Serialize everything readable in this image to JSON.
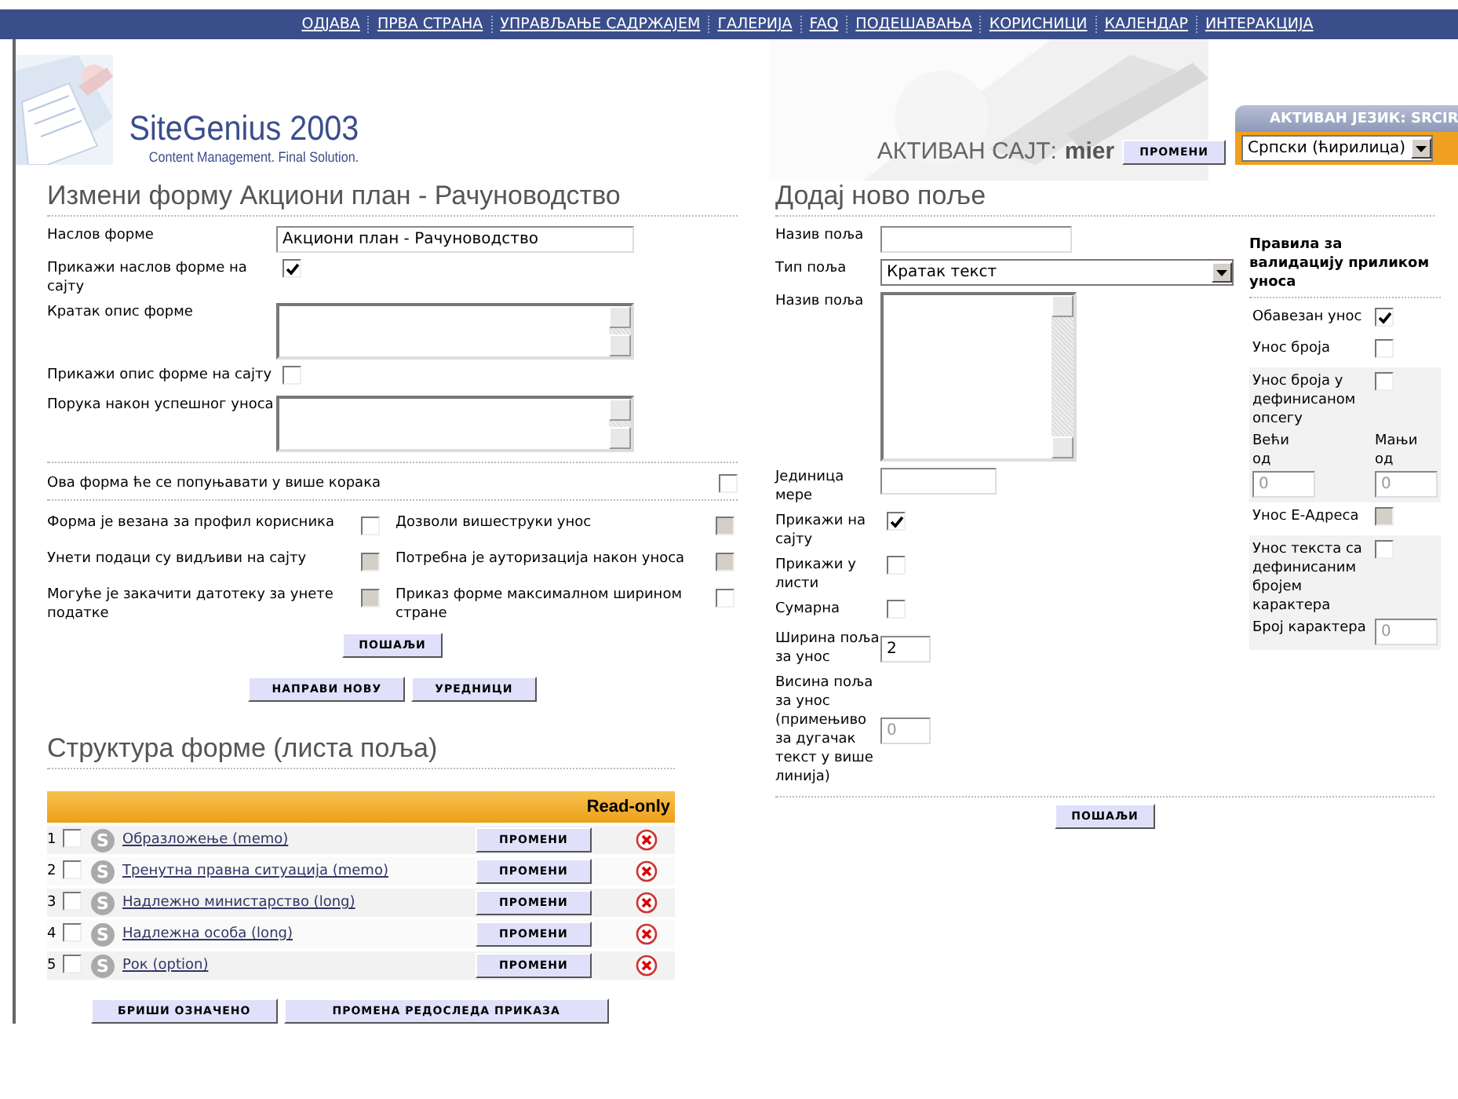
{
  "nav": [
    "ОДЈАВА",
    "ПРВА СТРАНА",
    "УПРАВЉАЊЕ САДРЖАЈЕМ",
    "ГАЛЕРИЈА",
    "FAQ",
    "ПОДЕШАВАЊА",
    "КОРИСНИЦИ",
    "КАЛЕНДАР",
    "ИНТЕРАКЦИЈА"
  ],
  "header": {
    "logo_title": "SiteGenius 2003",
    "logo_tagline": "Content Management. Final Solution.",
    "site_label": "АКТИВАН САЈТ:",
    "site_name": "mier",
    "change_button": "ПРОМЕНИ",
    "language_label": "АКТИВАН ЈЕЗИК: SRCIR",
    "language": "Српски (ћирилица)"
  },
  "edit_form": {
    "title": "Измени форму Акциони план - Рачуноводство",
    "fields": [
      {
        "kind": "text",
        "label": "Наслов форме",
        "value": "Акциони план - Рачуноводство"
      },
      {
        "kind": "checkbox",
        "label": "Прикажи наслов форме на сајту",
        "checked": true
      },
      {
        "kind": "textarea",
        "label": "Кратак опис форме"
      },
      {
        "kind": "checkbox",
        "label": "Прикажи опис форме на сајту",
        "checked": false
      },
      {
        "kind": "textarea",
        "label": "Порука након успешног уноса"
      }
    ],
    "wide_option": {
      "label": "Ова форма ће се попуњавати у више корака",
      "checked": false,
      "disabled": false
    },
    "options": [
      {
        "label": "Форма је везана за профил корисника",
        "checked": false,
        "disabled": false
      },
      {
        "label": "Дозволи вишеструки унос",
        "checked": false,
        "disabled": true
      },
      {
        "label": "Унети подаци су видљиви на сајту",
        "checked": false,
        "disabled": true
      },
      {
        "label": "Потребна је ауторизација након уноса",
        "checked": false,
        "disabled": true
      },
      {
        "label": "Могуће је закачити датотеку за унете податке",
        "checked": false,
        "disabled": true
      },
      {
        "label": "Приказ форме максималном ширином стране",
        "checked": false,
        "disabled": false
      }
    ],
    "submit": "ПОШАЉИ",
    "buttons": [
      "НАПРАВИ НОВУ",
      "УРЕДНИЦИ"
    ]
  },
  "structure": {
    "title": "Структура форме (листа поља)",
    "column_header": "Read-only",
    "rows": [
      {
        "number": "1",
        "checked": false,
        "badge": "S",
        "label": "Образложење (memo)",
        "button": "ПРОМЕНИ"
      },
      {
        "number": "2",
        "checked": false,
        "badge": "S",
        "label": "Тренутна правна ситуација (memo)",
        "button": "ПРОМЕНИ"
      },
      {
        "number": "3",
        "checked": false,
        "badge": "S",
        "label": "Надлежно министарство (long)",
        "button": "ПРОМЕНИ"
      },
      {
        "number": "4",
        "checked": false,
        "badge": "S",
        "label": "Надлежна особа (long)",
        "button": "ПРОМЕНИ"
      },
      {
        "number": "5",
        "checked": false,
        "badge": "S",
        "label": "Рок (option)",
        "button": "ПРОМЕНИ"
      }
    ],
    "buttons": [
      "БРИШИ ОЗНАЧЕНО",
      "ПРОМЕНА РЕДОСЛЕДА ПРИКАЗА"
    ]
  },
  "new_field": {
    "title": "Додај ново поље",
    "fields": [
      {
        "kind": "text",
        "label": "Назив поља"
      },
      {
        "kind": "select",
        "label": "Тип поља",
        "value": "Кратак текст"
      },
      {
        "kind": "textarea",
        "label": "Назив поља"
      },
      {
        "kind": "short",
        "label": "Јединица мере"
      },
      {
        "kind": "checkbox",
        "label": "Прикажи на сајту",
        "checked": true
      },
      {
        "kind": "checkbox",
        "label": "Прикажи у листи",
        "checked": false
      },
      {
        "kind": "checkbox",
        "label": "Сумарна",
        "checked": false
      },
      {
        "kind": "number",
        "label": "Ширина поља за унос",
        "value": "2"
      },
      {
        "kind": "number",
        "label": "Висина поља за унос (примењиво за дугачак текст у више линија)",
        "placeholder": "0"
      }
    ],
    "submit": "ПОШАЉИ",
    "validation": {
      "title": "Правила за валидацију приликом уноса",
      "rules": [
        {
          "kind": "checkbox",
          "label": "Обавезан унос",
          "checked": true,
          "disabled": false
        },
        {
          "kind": "checkbox",
          "label": "Унос броја",
          "checked": false,
          "disabled": false
        },
        {
          "kind": "range",
          "label": "Унос броја у дефинисаном опсегу",
          "checked": false,
          "disabled": false,
          "min_label": "Већи од",
          "max_label": "Мањи од",
          "min_placeholder": "0",
          "max_placeholder": "0"
        },
        {
          "kind": "checkbox",
          "label": "Унос Е-Адреса",
          "checked": false,
          "disabled": true
        },
        {
          "kind": "length",
          "label": "Унос текста са дефинисаним бројем карактера",
          "checked": false,
          "disabled": false,
          "count_label": "Број карактера",
          "count_placeholder": "0"
        }
      ]
    }
  }
}
